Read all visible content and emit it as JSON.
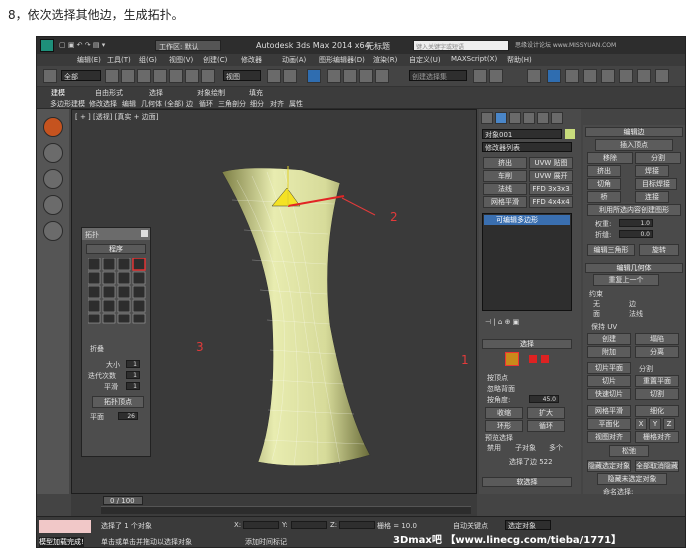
{
  "caption": "8，依次选择其他边，生成拓扑。",
  "titlebar": {
    "workspace": "工作区: 默认",
    "app": "Autodesk 3ds Max  2014 x64",
    "doc": "无标题",
    "search_placeholder": "键入关键字或短语",
    "watermark": "思缘设计论坛 www.MISSYUAN.COM"
  },
  "menubar": [
    "编辑(E)",
    "工具(T)",
    "组(G)",
    "视图(V)",
    "创建(C)",
    "修改器",
    "动画(A)",
    "图形编辑器(D)",
    "渲染(R)",
    "自定义(U)",
    "MAXScript(X)",
    "帮助(H)"
  ],
  "toolbar": {
    "filter": "全部",
    "view": "视图",
    "selset": "创建选择集"
  },
  "ribbon": {
    "tabs": [
      "建模",
      "自由形式",
      "选择",
      "对象绘制",
      "填充"
    ],
    "items": [
      "多边形建模",
      "修改选择",
      "编辑",
      "几何体 (全部)",
      "边",
      "循环",
      "三角剖分",
      "细分",
      "对齐",
      "属性"
    ]
  },
  "viewport": {
    "label": "[ + ] [透视] [真实 + 边面]"
  },
  "annotations": [
    "1",
    "2",
    "3"
  ],
  "topology": {
    "title": "拓扑",
    "section": "程序",
    "collapse_label": "折叠",
    "size_label": "大小",
    "iterations_label": "迭代次数",
    "smooth_label": "平滑",
    "rows_btn": "拓扑顶点",
    "plane_label": "平面",
    "size_val": "1",
    "iter_val": "1",
    "smooth_val": "1",
    "plane_val": "26"
  },
  "command_panel": {
    "object_name": "对象001",
    "modifier_list": "修改器列表",
    "buttons": [
      "挤出",
      "UVW 贴图",
      "车削",
      "UVW 展开",
      "法线",
      "FFD 3x3x3",
      "网格平滑",
      "FFD 4x4x4"
    ],
    "stack_item": "可编辑多边形"
  },
  "selection": {
    "title": "选择",
    "by_vertex": "按顶点",
    "ignore_back": "忽略背面",
    "by_angle": "按角度:",
    "angle_val": "45.0",
    "shrink": "收缩",
    "grow": "扩大",
    "ring": "环形",
    "loop": "循环",
    "preview": "预览选择",
    "disabled": "禁用",
    "subobj": "子对象",
    "multi": "多个",
    "status": "选择了边 522",
    "soft": "软选择"
  },
  "edit_edges": {
    "title": "编辑边",
    "insert_vertex": "插入顶点",
    "remove": "移除",
    "split": "分割",
    "extrude": "挤出",
    "weld": "焊接",
    "chamfer": "切角",
    "target_weld": "目标焊接",
    "bridge": "桥",
    "connect": "连接",
    "create_shape": "利用所选内容创建图形",
    "weight": "权重:",
    "crease": "折缝:",
    "weight_val": "1.0",
    "crease_val": "0.0",
    "edit_tri": "编辑三角形",
    "turn": "旋转"
  },
  "edit_geometry": {
    "title": "编辑几何体",
    "repeat_last": "重复上一个",
    "constraint": "约束",
    "none": "无",
    "edge": "边",
    "face": "面",
    "normal": "法线",
    "preserve_uv": "保持 UV",
    "create": "创建",
    "collapse": "塌陷",
    "attach": "附加",
    "detach": "分离",
    "slice_plane": "切片平面",
    "split": "分割",
    "slice": "切片",
    "reset_plane": "重置平面",
    "quickslice": "快速切片",
    "cut": "切割",
    "meshsmooth": "网格平滑",
    "tessellate": "细化",
    "make_planar": "平面化",
    "x": "X",
    "y": "Y",
    "z": "Z",
    "view_align": "视图对齐",
    "grid_align": "栅格对齐",
    "relax": "松弛",
    "hide_sel": "隐藏选定对象",
    "unhide_all": "全部取消隐藏",
    "hide_unsel": "隐藏未选定对象",
    "named_sel": "命名选择:",
    "copy": "复制",
    "paste": "粘贴",
    "delete_iso": "删除孤立顶点",
    "full_interact": "完全交互"
  },
  "timeline": {
    "frame": "0 / 100"
  },
  "status": {
    "selected": "选择了 1 个对象",
    "hint": "单击或单击并拖动以选择对象",
    "x_label": "X:",
    "y_label": "Y:",
    "z_label": "Z:",
    "grid": "栅格 = 10.0",
    "autokey": "自动关键点",
    "selset": "选定对象",
    "addtime": "添加时间标记",
    "maxscript": "模型加载完成!",
    "footer_watermark": "3Dmax吧 【www.linecg.com/tieba/1771】"
  }
}
